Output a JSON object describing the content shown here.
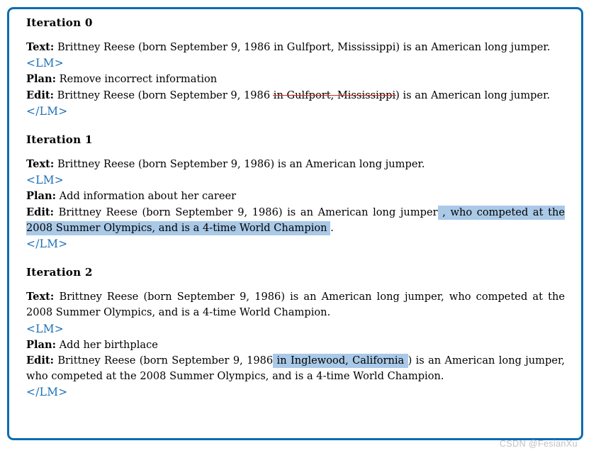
{
  "watermark": "CSDN @FesianXu",
  "labels": {
    "text": "Text:",
    "plan": "Plan:",
    "edit": "Edit:",
    "lm_open": "<LM>",
    "lm_close": "</LM>"
  },
  "colors": {
    "border": "#0b6cb0",
    "lm_tag": "#1b6fb5",
    "highlight": "#a9c9e7",
    "strikethrough": "#d42a1f",
    "watermark": "#c2c2c2",
    "body_text": "#000000"
  },
  "iterations": [
    {
      "title": "Iteration 0",
      "text": "Brittney Reese (born September 9, 1986 in Gulfport, Mississippi) is an American long jumper.",
      "plan": "Remove incorrect information",
      "edit": {
        "prefix": "Brittney Reese (born September 9, 1986 ",
        "deleted": "in Gulfport, Mississippi",
        "inserted": "",
        "suffix": ") is an American long jumper."
      }
    },
    {
      "title": "Iteration 1",
      "text": "Brittney Reese (born September 9, 1986) is an American long jumper.",
      "plan": "Add information about her career",
      "edit": {
        "prefix": "Brittney Reese (born September 9, 1986) is an American long jumper",
        "deleted": "",
        "inserted": " , who competed at the 2008 Summer Olympics, and is a 4-time World Champion ",
        "suffix": "."
      }
    },
    {
      "title": "Iteration 2",
      "text": "Brittney Reese (born September 9, 1986) is an American long jumper, who competed at the 2008 Summer Olympics, and is a 4-time World Champion.",
      "plan": "Add her birthplace",
      "edit": {
        "prefix": "Brittney Reese (born September 9, 1986",
        "deleted": "",
        "inserted": " in Inglewood, California ",
        "suffix": ") is an American long jumper, who competed at the 2008 Summer Olympics, and is a 4-time World Champion."
      }
    }
  ]
}
